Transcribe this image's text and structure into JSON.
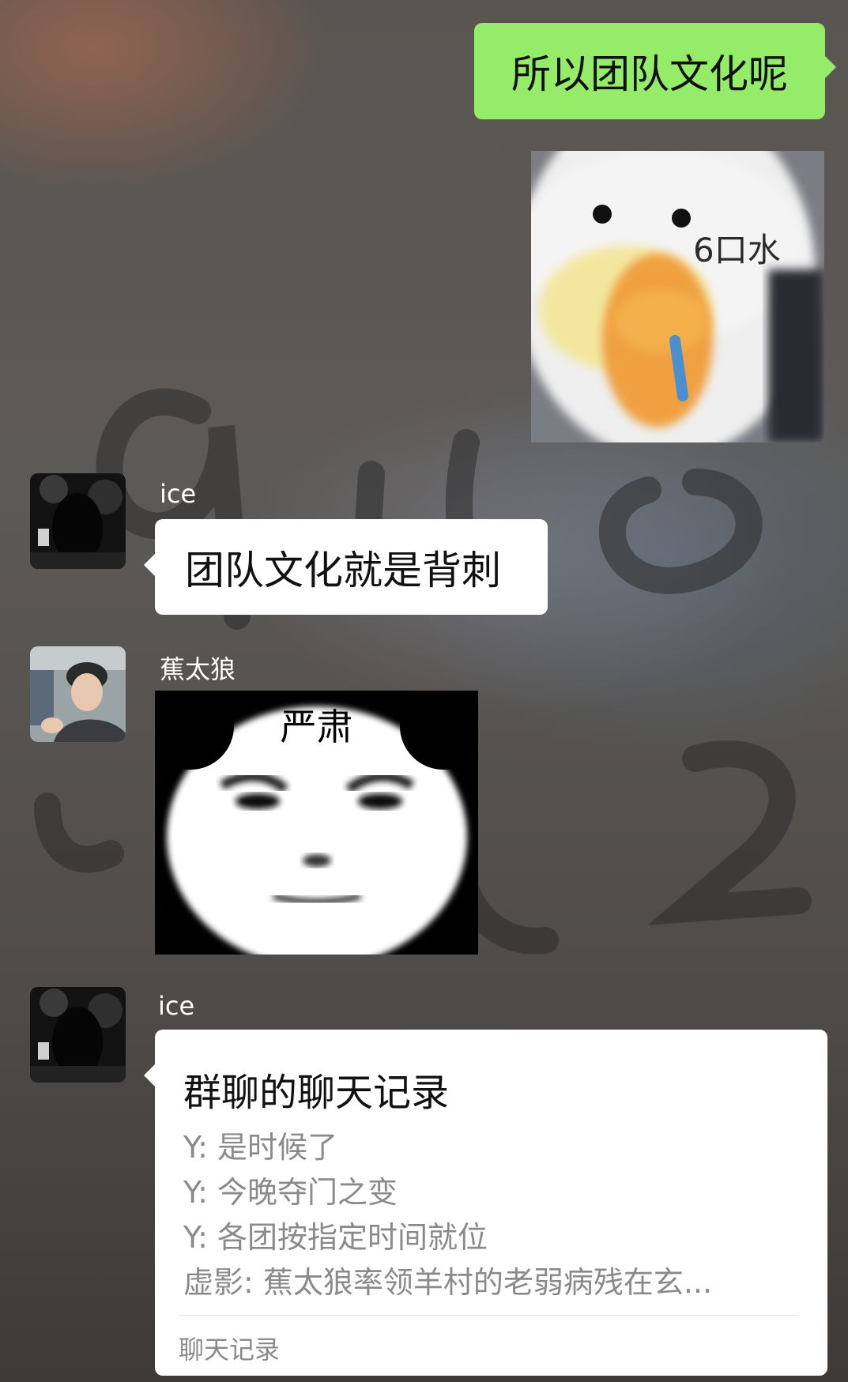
{
  "messages": {
    "outgoing_text": "所以团队文化呢",
    "duck_sticker_caption": "6口水",
    "ice_name_1": "ice",
    "ice_text": "团队文化就是背刺",
    "jiao_name": "蕉太狼",
    "panda_sticker_caption": "严肃",
    "ice_name_2": "ice"
  },
  "chat_record": {
    "title": "群聊的聊天记录",
    "lines": [
      "Y: 是时候了",
      "Y: 今晚夺门之变",
      "Y: 各团按指定时间就位",
      "虚影: 蕉太狼率领羊村的老弱病残在玄..."
    ],
    "footer": "聊天记录"
  },
  "colors": {
    "outgoing_bubble": "#95ec69",
    "incoming_bubble": "#ffffff"
  },
  "icons": [
    "avatar-ice",
    "avatar-jiaotailang",
    "duck-sticker",
    "panda-sticker"
  ]
}
